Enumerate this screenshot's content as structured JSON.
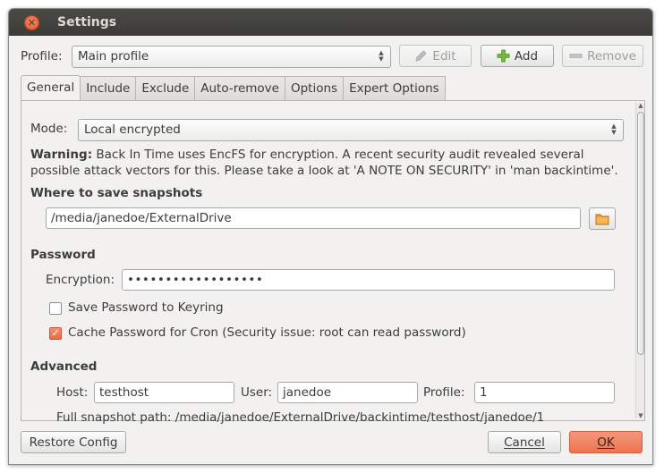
{
  "window": {
    "title": "Settings"
  },
  "profile": {
    "label": "Profile:",
    "selected": "Main profile",
    "edit_label": "Edit",
    "add_label": "Add",
    "remove_label": "Remove"
  },
  "tabs": [
    {
      "label": "General",
      "active": true
    },
    {
      "label": "Include"
    },
    {
      "label": "Exclude"
    },
    {
      "label": "Auto-remove"
    },
    {
      "label": "Options"
    },
    {
      "label": "Expert Options"
    }
  ],
  "general": {
    "mode_label": "Mode:",
    "mode_value": "Local encrypted",
    "warning_bold": "Warning:",
    "warning_line1": "Back In Time uses EncFS for encryption. A recent security audit revealed several",
    "warning_line2": "possible attack vectors for this. Please take a look at 'A NOTE ON SECURITY' in 'man backintime'.",
    "where_heading": "Where to save snapshots",
    "path_value": "/media/janedoe/ExternalDrive",
    "password_heading": "Password",
    "encryption_label": "Encryption:",
    "encryption_value": "••••••••••••••••••",
    "save_keyring_label": "Save Password to Keyring",
    "save_keyring_checked": false,
    "cache_cron_label": "Cache Password for Cron (Security issue: root can read password)",
    "cache_cron_checked": true,
    "advanced_heading": "Advanced",
    "host_label": "Host:",
    "host_value": "testhost",
    "user_label": "User:",
    "user_value": "janedoe",
    "profile_label": "Profile:",
    "profile_value": "1",
    "full_path_text": "Full snapshot path: /media/janedoe/ExternalDrive/backintime/testhost/janedoe/1"
  },
  "footer": {
    "restore_label": "Restore Config",
    "cancel_label": "Cancel",
    "ok_label": "OK"
  },
  "colors": {
    "accent": "#ec744f",
    "titlebar": "#3c3b37",
    "window_bg": "#f2f1f0"
  },
  "icons": {
    "edit": "pencil-icon",
    "add": "plus-icon",
    "remove": "minus-icon",
    "folder": "folder-icon",
    "close": "close-icon"
  }
}
